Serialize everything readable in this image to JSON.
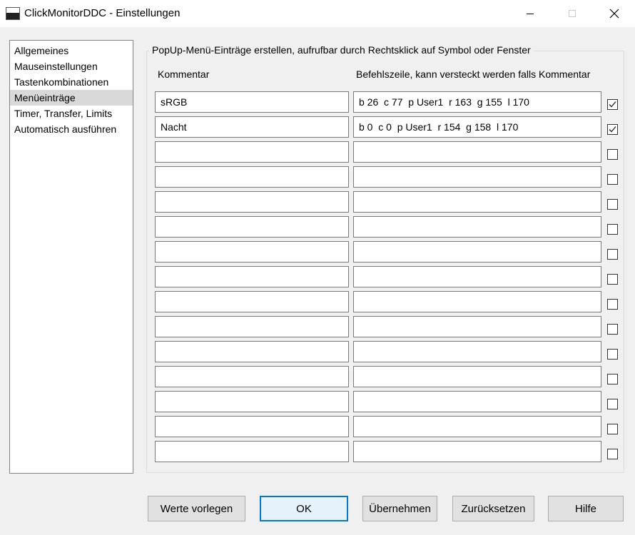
{
  "window": {
    "title": "ClickMonitorDDC - Einstellungen"
  },
  "nav": {
    "items": [
      {
        "label": "Allgemeines",
        "selected": false
      },
      {
        "label": "Mauseinstellungen",
        "selected": false
      },
      {
        "label": "Tastenkombinationen",
        "selected": false
      },
      {
        "label": "Menüeinträge",
        "selected": true
      },
      {
        "label": "Timer, Transfer, Limits",
        "selected": false
      },
      {
        "label": "Automatisch ausführen",
        "selected": false
      }
    ]
  },
  "group": {
    "title": "PopUp-Menü-Einträge erstellen, aufrufbar durch Rechtsklick auf Symbol oder Fenster",
    "col_comment": "Kommentar",
    "col_command": "Befehlszeile, kann versteckt werden falls Kommentar"
  },
  "entries": [
    {
      "comment": "sRGB",
      "command": "b 26  c 77  p User1  r 163  g 155  l 170",
      "checked": true
    },
    {
      "comment": "Nacht",
      "command": "b 0  c 0  p User1  r 154  g 158  l 170",
      "checked": true
    },
    {
      "comment": "",
      "command": "",
      "checked": false
    },
    {
      "comment": "",
      "command": "",
      "checked": false
    },
    {
      "comment": "",
      "command": "",
      "checked": false
    },
    {
      "comment": "",
      "command": "",
      "checked": false
    },
    {
      "comment": "",
      "command": "",
      "checked": false
    },
    {
      "comment": "",
      "command": "",
      "checked": false
    },
    {
      "comment": "",
      "command": "",
      "checked": false
    },
    {
      "comment": "",
      "command": "",
      "checked": false
    },
    {
      "comment": "",
      "command": "",
      "checked": false
    },
    {
      "comment": "",
      "command": "",
      "checked": false
    },
    {
      "comment": "",
      "command": "",
      "checked": false
    },
    {
      "comment": "",
      "command": "",
      "checked": false
    },
    {
      "comment": "",
      "command": "",
      "checked": false
    }
  ],
  "buttons": {
    "defaults": "Werte vorlegen",
    "ok": "OK",
    "apply": "Übernehmen",
    "reset": "Zurücksetzen",
    "help": "Hilfe"
  },
  "icons": {
    "app": "monitor-icon",
    "minimize": "minimize-icon",
    "maximize": "maximize-icon",
    "close": "close-icon",
    "check": "checkmark-icon"
  },
  "colors": {
    "focus_border": "#0078d7",
    "selection": "#d9d9d9"
  }
}
